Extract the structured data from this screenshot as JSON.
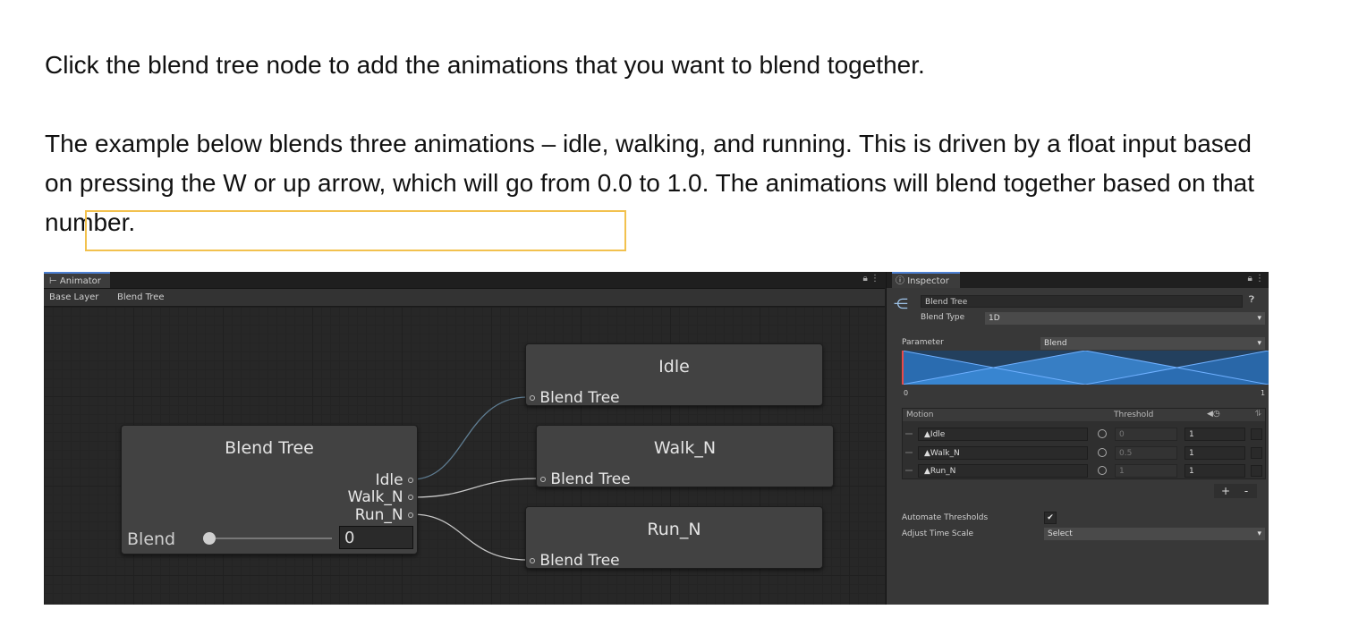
{
  "article": {
    "paragraph1": "Click the blend tree node to add the animations that you want to blend together.",
    "paragraph2": "The example below blends three animations – idle, walking, and running. This is driven by a float input based on pressing the W or up arrow, which will go from 0.0 to 1.0. The animations will blend together based on that number."
  },
  "animator": {
    "tab_label": "Animator",
    "breadcrumb": [
      "Base Layer",
      "Blend Tree"
    ],
    "root_node": {
      "title": "Blend Tree",
      "outputs": [
        "Idle",
        "Walk_N",
        "Run_N"
      ],
      "param_label": "Blend",
      "param_value": "0"
    },
    "child_nodes": [
      {
        "title": "Idle",
        "input": "Blend Tree"
      },
      {
        "title": "Walk_N",
        "input": "Blend Tree"
      },
      {
        "title": "Run_N",
        "input": "Blend Tree"
      }
    ]
  },
  "inspector": {
    "tab_label": "Inspector",
    "object_name": "Blend Tree",
    "blend_type_label": "Blend Type",
    "blend_type_value": "1D",
    "parameter_label": "Parameter",
    "parameter_value": "Blend",
    "range_min": "0",
    "range_max": "1",
    "motion_header": "Motion",
    "threshold_header": "Threshold",
    "motions": [
      {
        "name": "Idle",
        "threshold": "0",
        "speed": "1"
      },
      {
        "name": "Walk_N",
        "threshold": "0.5",
        "speed": "1"
      },
      {
        "name": "Run_N",
        "threshold": "1",
        "speed": "1"
      }
    ],
    "add_label": "+",
    "remove_label": "-",
    "automate_label": "Automate Thresholds",
    "automate_checked": true,
    "adjust_time_label": "Adjust Time Scale",
    "adjust_time_value": "Select"
  },
  "colors": {
    "highlight": "#f2c14e",
    "tab_accent": "#4c7fd1",
    "graph_blue": "#2e7fd0"
  }
}
